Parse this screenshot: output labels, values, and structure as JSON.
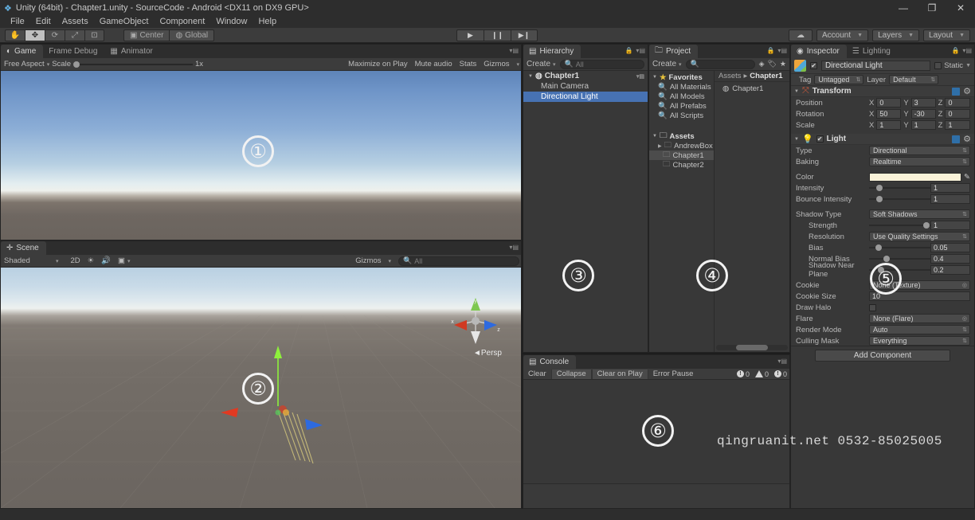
{
  "window": {
    "title": "Unity (64bit) - Chapter1.unity - SourceCode - Android <DX11 on DX9 GPU>",
    "minimize": "—",
    "maximize": "❐",
    "close": "✕"
  },
  "menu": {
    "items": [
      "File",
      "Edit",
      "Assets",
      "GameObject",
      "Component",
      "Window",
      "Help"
    ]
  },
  "toolbar": {
    "tools": [
      {
        "name": "hand-tool",
        "glyph": "✋"
      },
      {
        "name": "move-tool",
        "glyph": "✥"
      },
      {
        "name": "rotate-tool",
        "glyph": "⟳"
      },
      {
        "name": "scale-tool",
        "glyph": "⤢"
      },
      {
        "name": "rect-tool",
        "glyph": "⊡"
      }
    ],
    "pivot": "Center",
    "space": "Global",
    "play": "▶",
    "pause": "❙❙",
    "step": "▶❙",
    "cloud": "☁",
    "account": "Account",
    "layers": "Layers",
    "layout": "Layout"
  },
  "game": {
    "tabs": [
      {
        "label": "Game",
        "icon": "game-icon",
        "active": true
      },
      {
        "label": "Frame Debug",
        "icon": "",
        "active": false
      },
      {
        "label": "Animator",
        "icon": "animator-icon",
        "active": false
      }
    ],
    "aspect": "Free Aspect",
    "scale_label": "Scale",
    "scale_value": "1x",
    "maximize_on_play": "Maximize on Play",
    "mute_audio": "Mute audio",
    "stats": "Stats",
    "gizmos": "Gizmos"
  },
  "scene": {
    "tab": "Scene",
    "shading": "Shaded",
    "two_d": "2D",
    "light_toggle": "☀",
    "audio_toggle": "🔊",
    "fx_toggle": "▣",
    "gizmos": "Gizmos",
    "search_placeholder": "All",
    "perspective_label": "Persp",
    "gizmo_axes": {
      "x": "x",
      "y": "y",
      "z": "z"
    }
  },
  "hierarchy": {
    "tab": "Hierarchy",
    "create": "Create",
    "search_placeholder": "All",
    "scene_name": "Chapter1",
    "objects": [
      {
        "label": "Main Camera",
        "selected": false
      },
      {
        "label": "Directional Light",
        "selected": true
      }
    ]
  },
  "project": {
    "tab": "Project",
    "create": "Create",
    "search_placeholder": "",
    "favorites_label": "Favorites",
    "favorites": [
      "All Materials",
      "All Models",
      "All Prefabs",
      "All Scripts"
    ],
    "assets_label": "Assets",
    "folders": [
      {
        "label": "AndrewBox",
        "expandable": true,
        "selected": false
      },
      {
        "label": "Chapter1",
        "expandable": false,
        "selected": true
      },
      {
        "label": "Chapter2",
        "expandable": false,
        "selected": false
      }
    ],
    "breadcrumb_root": "Assets",
    "breadcrumb_sep": "▸",
    "breadcrumb_current": "Chapter1",
    "asset_items": [
      {
        "label": "Chapter1",
        "icon": "scene-icon"
      }
    ]
  },
  "console": {
    "tab": "Console",
    "clear": "Clear",
    "collapse": "Collapse",
    "clear_on_play": "Clear on Play",
    "error_pause": "Error Pause",
    "counts": {
      "info": "0",
      "warning": "0",
      "error": "0"
    }
  },
  "inspector": {
    "tabs": [
      {
        "label": "Inspector",
        "active": true
      },
      {
        "label": "Lighting",
        "active": false
      }
    ],
    "object_name": "Directional Light",
    "enabled": true,
    "static_label": "Static",
    "tag_label": "Tag",
    "tag_value": "Untagged",
    "layer_label": "Layer",
    "layer_value": "Default",
    "transform": {
      "title": "Transform",
      "rows": [
        {
          "label": "Position",
          "x": "0",
          "y": "3",
          "z": "0"
        },
        {
          "label": "Rotation",
          "x": "50",
          "y": "-30",
          "z": "0"
        },
        {
          "label": "Scale",
          "x": "1",
          "y": "1",
          "z": "1"
        }
      ],
      "axis_labels": {
        "x": "X",
        "y": "Y",
        "z": "Z"
      }
    },
    "light": {
      "title": "Light",
      "type_label": "Type",
      "type_value": "Directional",
      "baking_label": "Baking",
      "baking_value": "Realtime",
      "color_label": "Color",
      "color_value": "#faf3d9",
      "intensity_label": "Intensity",
      "intensity_value": "1",
      "intensity_pct": 12,
      "bounce_label": "Bounce Intensity",
      "bounce_value": "1",
      "bounce_pct": 12,
      "shadow_type_label": "Shadow Type",
      "shadow_type_value": "Soft Shadows",
      "strength_label": "Strength",
      "strength_value": "1",
      "strength_pct": 88,
      "resolution_label": "Resolution",
      "resolution_value": "Use Quality Settings",
      "bias_label": "Bias",
      "bias_value": "0.05",
      "bias_pct": 10,
      "normal_bias_label": "Normal Bias",
      "normal_bias_value": "0.4",
      "normal_bias_pct": 24,
      "near_plane_label": "Shadow Near Plane",
      "near_plane_value": "0.2",
      "near_plane_pct": 14,
      "cookie_label": "Cookie",
      "cookie_value": "None (Texture)",
      "cookie_size_label": "Cookie Size",
      "cookie_size_value": "10",
      "draw_halo_label": "Draw Halo",
      "flare_label": "Flare",
      "flare_value": "None (Flare)",
      "render_mode_label": "Render Mode",
      "render_mode_value": "Auto",
      "culling_label": "Culling Mask",
      "culling_value": "Everything"
    },
    "add_component": "Add Component"
  },
  "annotations": [
    {
      "number": "①",
      "target": "game-view"
    },
    {
      "number": "②",
      "target": "scene-view"
    },
    {
      "number": "③",
      "target": "hierarchy-panel"
    },
    {
      "number": "④",
      "target": "project-panel"
    },
    {
      "number": "⑤",
      "target": "inspector-light"
    },
    {
      "number": "⑥",
      "target": "console-panel"
    }
  ],
  "watermark": {
    "text": "qingruanit.net 0532-85025005"
  }
}
